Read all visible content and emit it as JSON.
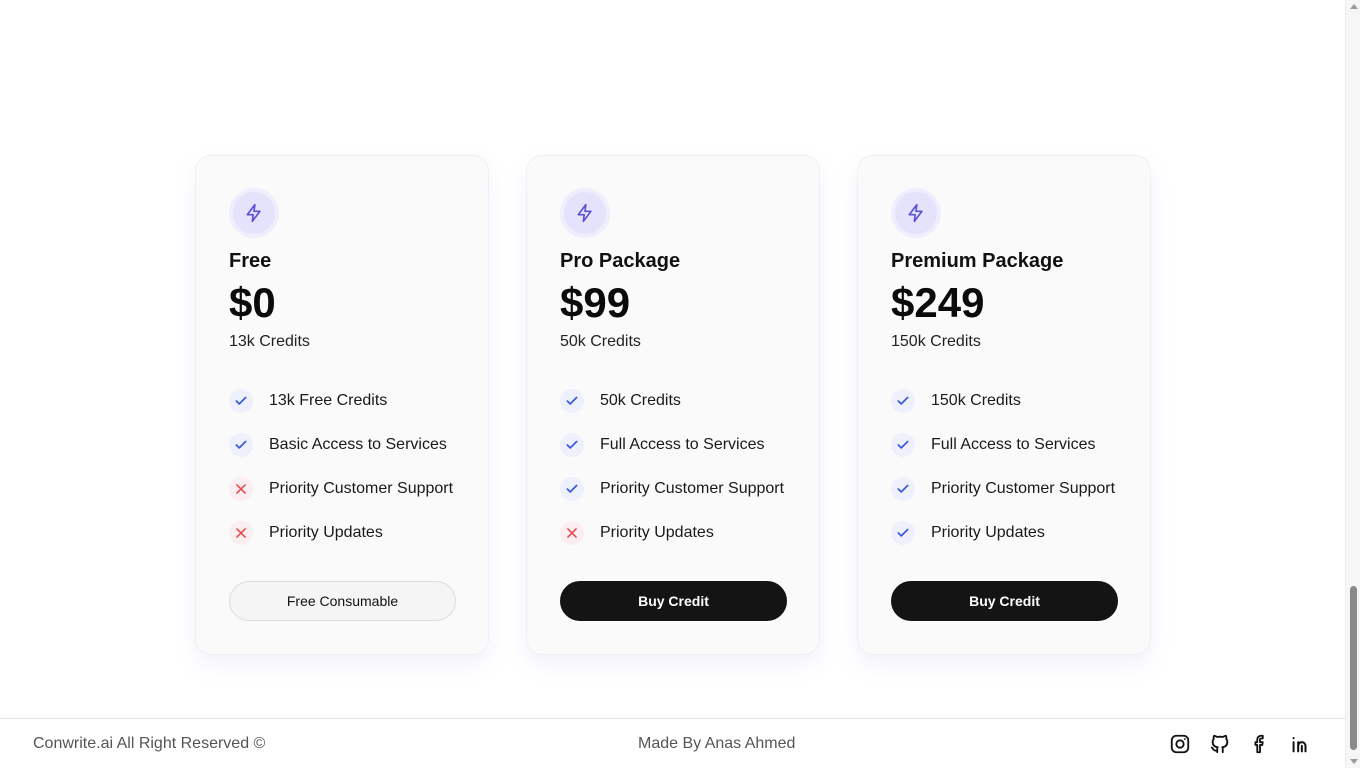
{
  "plans": [
    {
      "name": "Free",
      "price": "$0",
      "credits": "13k Credits",
      "features": [
        {
          "label": "13k Free Credits",
          "included": true
        },
        {
          "label": "Basic Access to Services",
          "included": true
        },
        {
          "label": "Priority Customer Support",
          "included": false
        },
        {
          "label": "Priority Updates",
          "included": false
        }
      ],
      "cta_label": "Free Consumable",
      "cta_style": "light"
    },
    {
      "name": "Pro Package",
      "price": "$99",
      "credits": "50k Credits",
      "features": [
        {
          "label": "50k Credits",
          "included": true
        },
        {
          "label": "Full Access to Services",
          "included": true
        },
        {
          "label": "Priority Customer Support",
          "included": true
        },
        {
          "label": "Priority Updates",
          "included": false
        }
      ],
      "cta_label": "Buy Credit",
      "cta_style": "dark"
    },
    {
      "name": "Premium Package",
      "price": "$249",
      "credits": "150k Credits",
      "features": [
        {
          "label": "150k Credits",
          "included": true
        },
        {
          "label": "Full Access to Services",
          "included": true
        },
        {
          "label": "Priority Customer Support",
          "included": true
        },
        {
          "label": "Priority Updates",
          "included": true
        }
      ],
      "cta_label": "Buy Credit",
      "cta_style": "dark"
    }
  ],
  "icons": {
    "plan_icon": "lightning-bolt-icon",
    "included": "check-icon",
    "excluded": "cross-icon"
  },
  "colors": {
    "accent": "#5b50d6",
    "check": "#3b5bd6",
    "cross": "#e5484d",
    "button_dark": "#141414"
  },
  "footer": {
    "copyright": "Conwrite.ai All Right Reserved ©",
    "credit": "Made By Anas Ahmed",
    "social": [
      "instagram-icon",
      "github-icon",
      "facebook-icon",
      "linkedin-icon"
    ]
  }
}
